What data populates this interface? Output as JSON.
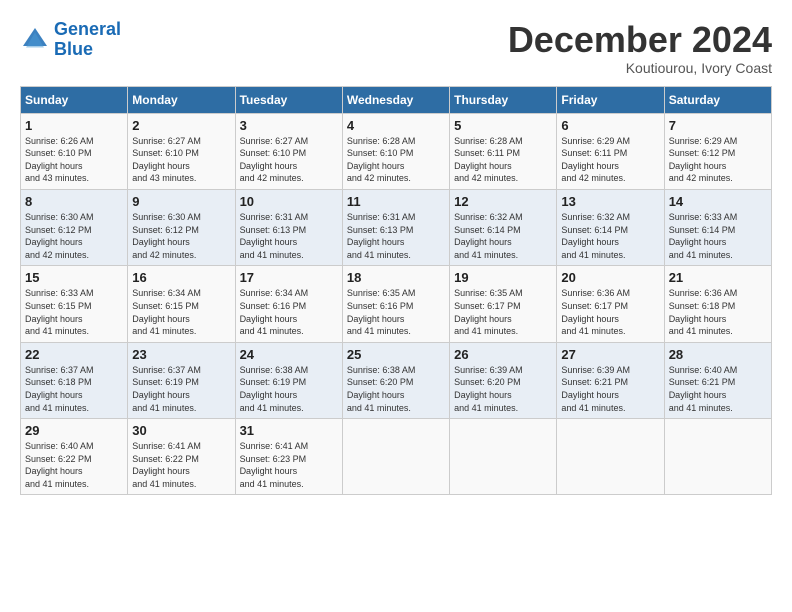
{
  "header": {
    "logo_line1": "General",
    "logo_line2": "Blue",
    "title": "December 2024",
    "subtitle": "Koutiourou, Ivory Coast"
  },
  "days_of_week": [
    "Sunday",
    "Monday",
    "Tuesday",
    "Wednesday",
    "Thursday",
    "Friday",
    "Saturday"
  ],
  "weeks": [
    [
      {
        "day": "1",
        "sunrise": "6:26 AM",
        "sunset": "6:10 PM",
        "daylight": "11 hours and 43 minutes."
      },
      {
        "day": "2",
        "sunrise": "6:27 AM",
        "sunset": "6:10 PM",
        "daylight": "11 hours and 43 minutes."
      },
      {
        "day": "3",
        "sunrise": "6:27 AM",
        "sunset": "6:10 PM",
        "daylight": "11 hours and 42 minutes."
      },
      {
        "day": "4",
        "sunrise": "6:28 AM",
        "sunset": "6:10 PM",
        "daylight": "11 hours and 42 minutes."
      },
      {
        "day": "5",
        "sunrise": "6:28 AM",
        "sunset": "6:11 PM",
        "daylight": "11 hours and 42 minutes."
      },
      {
        "day": "6",
        "sunrise": "6:29 AM",
        "sunset": "6:11 PM",
        "daylight": "11 hours and 42 minutes."
      },
      {
        "day": "7",
        "sunrise": "6:29 AM",
        "sunset": "6:12 PM",
        "daylight": "11 hours and 42 minutes."
      }
    ],
    [
      {
        "day": "8",
        "sunrise": "6:30 AM",
        "sunset": "6:12 PM",
        "daylight": "11 hours and 42 minutes."
      },
      {
        "day": "9",
        "sunrise": "6:30 AM",
        "sunset": "6:12 PM",
        "daylight": "11 hours and 42 minutes."
      },
      {
        "day": "10",
        "sunrise": "6:31 AM",
        "sunset": "6:13 PM",
        "daylight": "11 hours and 41 minutes."
      },
      {
        "day": "11",
        "sunrise": "6:31 AM",
        "sunset": "6:13 PM",
        "daylight": "11 hours and 41 minutes."
      },
      {
        "day": "12",
        "sunrise": "6:32 AM",
        "sunset": "6:14 PM",
        "daylight": "11 hours and 41 minutes."
      },
      {
        "day": "13",
        "sunrise": "6:32 AM",
        "sunset": "6:14 PM",
        "daylight": "11 hours and 41 minutes."
      },
      {
        "day": "14",
        "sunrise": "6:33 AM",
        "sunset": "6:14 PM",
        "daylight": "11 hours and 41 minutes."
      }
    ],
    [
      {
        "day": "15",
        "sunrise": "6:33 AM",
        "sunset": "6:15 PM",
        "daylight": "11 hours and 41 minutes."
      },
      {
        "day": "16",
        "sunrise": "6:34 AM",
        "sunset": "6:15 PM",
        "daylight": "11 hours and 41 minutes."
      },
      {
        "day": "17",
        "sunrise": "6:34 AM",
        "sunset": "6:16 PM",
        "daylight": "11 hours and 41 minutes."
      },
      {
        "day": "18",
        "sunrise": "6:35 AM",
        "sunset": "6:16 PM",
        "daylight": "11 hours and 41 minutes."
      },
      {
        "day": "19",
        "sunrise": "6:35 AM",
        "sunset": "6:17 PM",
        "daylight": "11 hours and 41 minutes."
      },
      {
        "day": "20",
        "sunrise": "6:36 AM",
        "sunset": "6:17 PM",
        "daylight": "11 hours and 41 minutes."
      },
      {
        "day": "21",
        "sunrise": "6:36 AM",
        "sunset": "6:18 PM",
        "daylight": "11 hours and 41 minutes."
      }
    ],
    [
      {
        "day": "22",
        "sunrise": "6:37 AM",
        "sunset": "6:18 PM",
        "daylight": "11 hours and 41 minutes."
      },
      {
        "day": "23",
        "sunrise": "6:37 AM",
        "sunset": "6:19 PM",
        "daylight": "11 hours and 41 minutes."
      },
      {
        "day": "24",
        "sunrise": "6:38 AM",
        "sunset": "6:19 PM",
        "daylight": "11 hours and 41 minutes."
      },
      {
        "day": "25",
        "sunrise": "6:38 AM",
        "sunset": "6:20 PM",
        "daylight": "11 hours and 41 minutes."
      },
      {
        "day": "26",
        "sunrise": "6:39 AM",
        "sunset": "6:20 PM",
        "daylight": "11 hours and 41 minutes."
      },
      {
        "day": "27",
        "sunrise": "6:39 AM",
        "sunset": "6:21 PM",
        "daylight": "11 hours and 41 minutes."
      },
      {
        "day": "28",
        "sunrise": "6:40 AM",
        "sunset": "6:21 PM",
        "daylight": "11 hours and 41 minutes."
      }
    ],
    [
      {
        "day": "29",
        "sunrise": "6:40 AM",
        "sunset": "6:22 PM",
        "daylight": "11 hours and 41 minutes."
      },
      {
        "day": "30",
        "sunrise": "6:41 AM",
        "sunset": "6:22 PM",
        "daylight": "11 hours and 41 minutes."
      },
      {
        "day": "31",
        "sunrise": "6:41 AM",
        "sunset": "6:23 PM",
        "daylight": "11 hours and 41 minutes."
      },
      null,
      null,
      null,
      null
    ]
  ]
}
